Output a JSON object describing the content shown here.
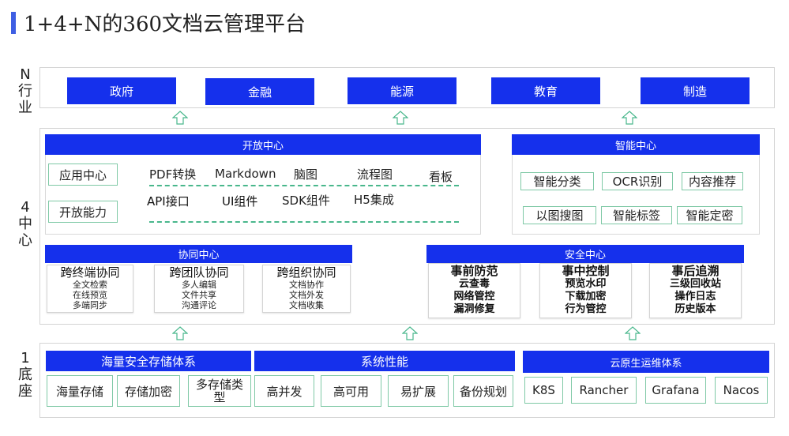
{
  "title": "1+4+N的360文档云管理平台",
  "tiers": {
    "n": [
      "N",
      "行",
      "业"
    ],
    "four": [
      "4",
      "中",
      "心"
    ],
    "one": [
      "1",
      "底",
      "座"
    ]
  },
  "industries": [
    "政府",
    "金融",
    "能源",
    "教育",
    "制造"
  ],
  "open_center": {
    "title": "开放中心",
    "tags": [
      "应用中心",
      "开放能力"
    ],
    "row1": [
      "PDF转换",
      "Markdown",
      "脑图",
      "流程图",
      "看板"
    ],
    "row2": [
      "API接口",
      "UI组件",
      "SDK组件",
      "H5集成"
    ]
  },
  "smart_center": {
    "title": "智能中心",
    "tags": [
      "智能分类",
      "OCR识别",
      "内容推荐",
      "以图搜图",
      "智能标签",
      "智能定密"
    ]
  },
  "collab_center": {
    "title": "协同中心",
    "cards": [
      {
        "head": "跨终端协同",
        "items": [
          "全文检索",
          "在线预览",
          "多端同步"
        ]
      },
      {
        "head": "跨团队协同",
        "items": [
          "多人编辑",
          "文件共享",
          "沟通评论"
        ]
      },
      {
        "head": "跨组织协同",
        "items": [
          "文档协作",
          "文档外发",
          "文档收集"
        ]
      }
    ]
  },
  "security_center": {
    "title": "安全中心",
    "cards": [
      {
        "head": "事前防范",
        "items": [
          "云查毒",
          "网络管控",
          "漏洞修复"
        ]
      },
      {
        "head": "事中控制",
        "items": [
          "预览水印",
          "下载加密",
          "行为管控"
        ]
      },
      {
        "head": "事后追溯",
        "items": [
          "三级回收站",
          "操作日志",
          "历史版本"
        ]
      }
    ]
  },
  "storage": {
    "title": "海量安全存储体系",
    "items": [
      "海量存储",
      "存储加密",
      "多存储类型"
    ]
  },
  "performance": {
    "title": "系统性能",
    "items": [
      "高并发",
      "高可用",
      "易扩展",
      "备份规划"
    ]
  },
  "ops": {
    "title": "云原生运维体系",
    "items": [
      "K8S",
      "Rancher",
      "Grafana",
      "Nacos"
    ]
  },
  "colors": {
    "blue": "#1530ec",
    "green_border": "#7fc9a6",
    "dash": "#49b78c",
    "title_accent": "#3f5fe3"
  }
}
